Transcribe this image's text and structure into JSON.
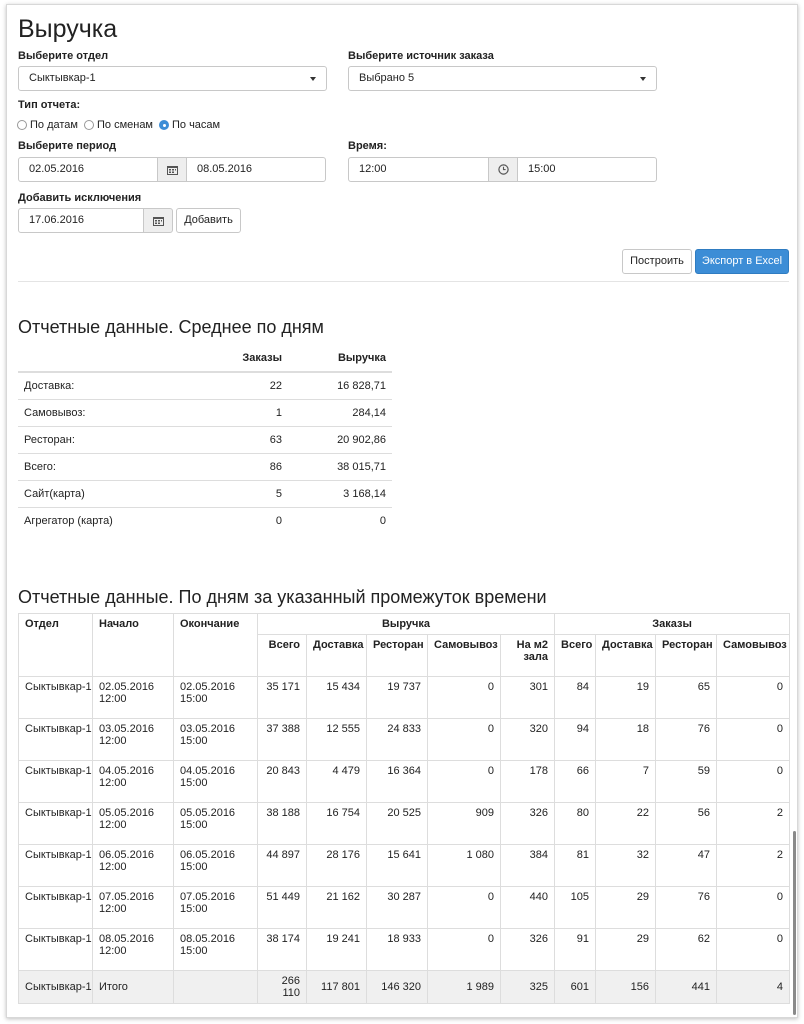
{
  "page_title": "Выручка",
  "filters": {
    "department_label": "Выберите отдел",
    "department_value": "Сыктывкар-1",
    "source_label": "Выберите источник заказа",
    "source_value": "Выбрано 5",
    "report_type_label": "Тип отчета:",
    "report_types": [
      "По датам",
      "По сменам",
      "По часам"
    ],
    "report_type_selected": "По часам",
    "period_label": "Выберите период",
    "period_from": "02.05.2016",
    "period_to": "08.05.2016",
    "time_label": "Время:",
    "time_from": "12:00",
    "time_to": "15:00",
    "exclusions_label": "Добавить исключения",
    "exclusion_date": "17.06.2016",
    "add_button": "Добавить",
    "build_button": "Построить",
    "export_button": "Экспорт в Excel"
  },
  "summary": {
    "title": "Отчетные данные. Среднее по дням",
    "headers": [
      "",
      "Заказы",
      "Выручка"
    ],
    "rows": [
      {
        "label": "Доставка:",
        "orders": "22",
        "revenue": "16 828,71"
      },
      {
        "label": "Самовывоз:",
        "orders": "1",
        "revenue": "284,14"
      },
      {
        "label": "Ресторан:",
        "orders": "63",
        "revenue": "20 902,86"
      },
      {
        "label": "Всего:",
        "orders": "86",
        "revenue": "38 015,71"
      },
      {
        "label": "Сайт(карта)",
        "orders": "5",
        "revenue": "3 168,14"
      },
      {
        "label": "Агрегатор (карта)",
        "orders": "0",
        "revenue": "0"
      }
    ]
  },
  "daily": {
    "title": "Отчетные данные. По дням за указанный промежуток времени",
    "group_headers": {
      "dept": "Отдел",
      "start": "Начало",
      "end": "Окончание",
      "revenue": "Выручка",
      "orders": "Заказы"
    },
    "sub_headers": [
      "Всего",
      "Доставка",
      "Ресторан",
      "Самовывоз",
      "На м2 зала",
      "Всего",
      "Доставка",
      "Ресторан",
      "Самовывоз"
    ],
    "rows": [
      [
        "Сыктывкар-1",
        "02.05.2016 12:00",
        "02.05.2016 15:00",
        "35 171",
        "15 434",
        "19 737",
        "0",
        "301",
        "84",
        "19",
        "65",
        "0"
      ],
      [
        "Сыктывкар-1",
        "03.05.2016 12:00",
        "03.05.2016 15:00",
        "37 388",
        "12 555",
        "24 833",
        "0",
        "320",
        "94",
        "18",
        "76",
        "0"
      ],
      [
        "Сыктывкар-1",
        "04.05.2016 12:00",
        "04.05.2016 15:00",
        "20 843",
        "4 479",
        "16 364",
        "0",
        "178",
        "66",
        "7",
        "59",
        "0"
      ],
      [
        "Сыктывкар-1",
        "05.05.2016 12:00",
        "05.05.2016 15:00",
        "38 188",
        "16 754",
        "20 525",
        "909",
        "326",
        "80",
        "22",
        "56",
        "2"
      ],
      [
        "Сыктывкар-1",
        "06.05.2016 12:00",
        "06.05.2016 15:00",
        "44 897",
        "28 176",
        "15 641",
        "1 080",
        "384",
        "81",
        "32",
        "47",
        "2"
      ],
      [
        "Сыктывкар-1",
        "07.05.2016 12:00",
        "07.05.2016 15:00",
        "51 449",
        "21 162",
        "30 287",
        "0",
        "440",
        "105",
        "29",
        "76",
        "0"
      ],
      [
        "Сыктывкар-1",
        "08.05.2016 12:00",
        "08.05.2016 15:00",
        "38 174",
        "19 241",
        "18 933",
        "0",
        "326",
        "91",
        "29",
        "62",
        "0"
      ]
    ],
    "total": [
      "Сыктывкар-1",
      "Итого",
      "",
      "266 110",
      "117 801",
      "146 320",
      "1 989",
      "325",
      "601",
      "156",
      "441",
      "4"
    ]
  }
}
